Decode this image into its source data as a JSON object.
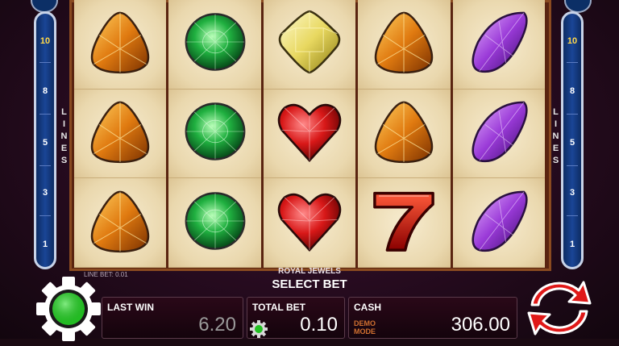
{
  "game": {
    "title": "ROYAL JEWELS",
    "status_line": "LINE BET: 0.01",
    "prompt": "SELECT BET"
  },
  "lines": {
    "label": [
      "L",
      "I",
      "N",
      "E",
      "S"
    ],
    "values": [
      "10",
      "8",
      "5",
      "3",
      "1"
    ],
    "active": "10"
  },
  "reels": [
    [
      "orange-trillion-gem",
      "orange-trillion-gem",
      "orange-trillion-gem"
    ],
    [
      "green-round-gem",
      "green-round-gem",
      "green-round-gem"
    ],
    [
      "yellow-square-gem",
      "red-heart-gem",
      "red-heart-gem"
    ],
    [
      "orange-trillion-gem",
      "orange-trillion-gem",
      "red-seven"
    ],
    [
      "purple-marquise-gem",
      "purple-marquise-gem",
      "purple-marquise-gem"
    ]
  ],
  "panels": {
    "last_win": {
      "label": "LAST WIN",
      "value": "6.20"
    },
    "total_bet": {
      "label": "TOTAL BET",
      "value": "0.10"
    },
    "cash": {
      "label": "CASH",
      "value": "306.00",
      "mode_line1": "DEMO",
      "mode_line2": "MODE"
    }
  },
  "icons": {
    "settings": "gear-icon",
    "spin": "spin-arrows-icon",
    "bet_settings": "small-gear-icon"
  },
  "colors": {
    "spin_red": "#e01818",
    "gear_green": "#22c022",
    "line_bar_blue": "#1a4596",
    "active_line": "#ffd84a"
  }
}
